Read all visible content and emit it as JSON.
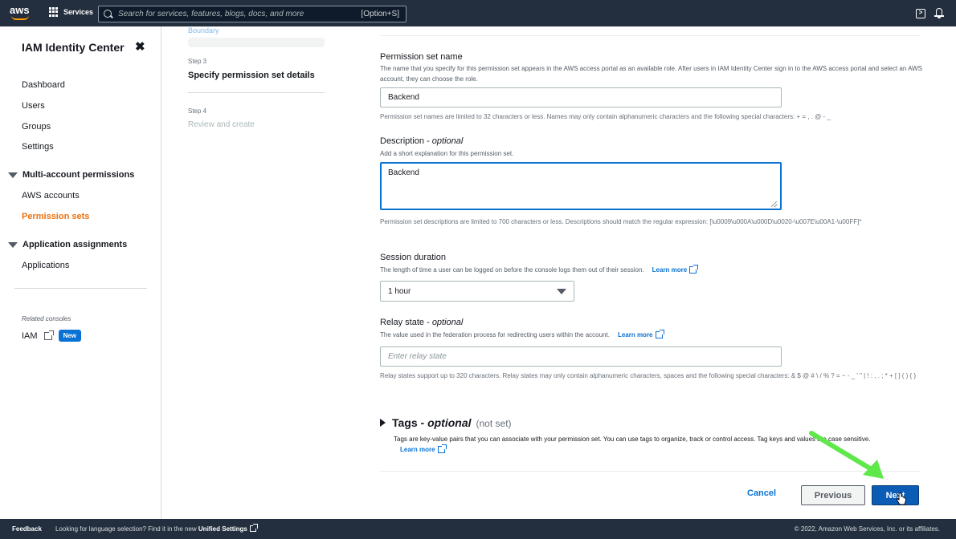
{
  "topnav": {
    "logo_text": "aws",
    "services_label": "Services",
    "search_placeholder": "Search for services, features, blogs, docs, and more",
    "search_hint": "[Option+S]"
  },
  "sidebar": {
    "title": "IAM Identity Center",
    "close_glyph": "✖",
    "links": [
      "Dashboard",
      "Users",
      "Groups",
      "Settings"
    ],
    "section_multi": "Multi-account permissions",
    "multi_links": [
      "AWS accounts",
      "Permission sets"
    ],
    "section_app": "Application assignments",
    "app_links": [
      "Applications"
    ],
    "related_label": "Related consoles",
    "iam_label": "IAM",
    "new_badge": "New",
    "active_color": "#ec7211"
  },
  "steps": {
    "top_faded": "Boundary",
    "step3_num": "Step 3",
    "step3_title": "Specify permission set details",
    "step4_num": "Step 4",
    "step4_title": "Review and create"
  },
  "form": {
    "name_label": "Permission set name",
    "name_desc": "The name that you specify for this permission set appears in the AWS access portal as an available role. After users in IAM Identity Center sign in to the AWS access portal and select an AWS account, they can choose the role.",
    "name_value": "Backend",
    "name_help": "Permission set names are limited to 32 characters or less. Names may only contain alphanumeric characters and the following special characters: + = , . @ - _",
    "desc_label": "Description - ",
    "desc_optional": "optional",
    "desc_desc": "Add a short explanation for this permission set.",
    "desc_value": "Backend",
    "desc_help": "Permission set descriptions are limited to 700 characters or less. Descriptions should match the regular expression: [\\u0009\\u000A\\u000D\\u0020-\\u007E\\u00A1-\\u00FF]*",
    "session_label": "Session duration",
    "session_desc": "The length of time a user can be logged on before the console logs them out of their session.",
    "session_value": "1 hour",
    "relay_label": "Relay state - ",
    "relay_optional": "optional",
    "relay_desc": "The value used in the federation process for redirecting users within the account.",
    "relay_placeholder": "Enter relay state",
    "relay_help": "Relay states support up to 320 characters. Relay states may only contain alphanumeric characters, spaces and the following special characters: & $ @ # \\ / % ? = ~ - _ ' \" | ! : , . ; * + [ ] ( ) { }",
    "learn_more": "Learn more"
  },
  "tags": {
    "title": "Tags - ",
    "optional": "optional",
    "status": "(not set)",
    "desc": "Tags are key-value pairs that you can associate with your permission set. You can use tags to organize, track or control access. Tag keys and values are case sensitive."
  },
  "actions": {
    "cancel": "Cancel",
    "previous": "Previous",
    "next": "Next"
  },
  "footer": {
    "feedback": "Feedback",
    "lang_text": "Looking for language selection? Find it in the new ",
    "lang_link": "Unified Settings",
    "copyright": "© 2022, Amazon Web Services, Inc. or its affiliates."
  },
  "colors": {
    "nav_bg": "#232f3e",
    "link": "#0972d3",
    "primary_button": "#0a5cb5",
    "annotation_arrow": "#5ee84a"
  }
}
